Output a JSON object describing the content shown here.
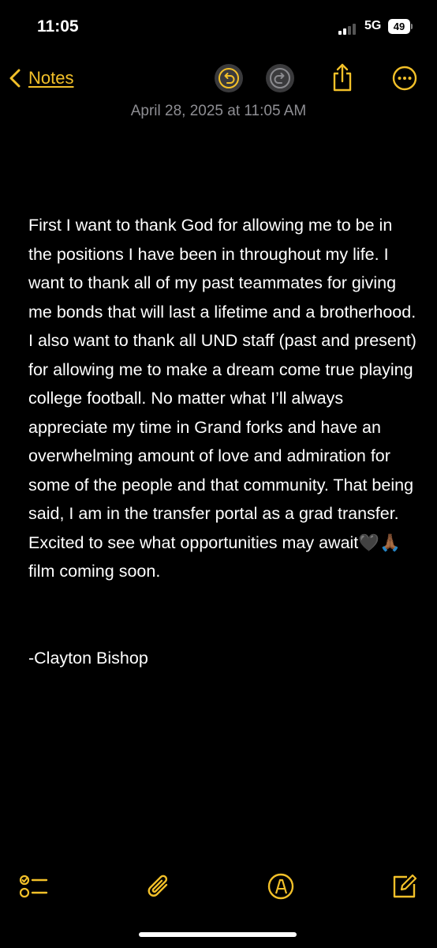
{
  "status_bar": {
    "time": "11:05",
    "network": "5G",
    "battery": "49"
  },
  "nav": {
    "back_label": "Notes"
  },
  "note": {
    "date": "April 28, 2025 at 11:05 AM",
    "body": "First I want to thank God for allowing me to be in the positions I have been in throughout my life. I want to thank all of my past teammates for giving me bonds that will last a lifetime and a brotherhood. I also want to thank all UND staff (past and present) for allowing me to make a dream come true playing college football. No matter what I’ll always appreciate my time in Grand forks and have an overwhelming amount of love and admiration for some of the people and that community. That being said, I am in the transfer portal as a grad transfer. Excited to see what opportunities may await🖤🙏🏾 film coming soon.\n\n\n-Clayton Bishop"
  },
  "colors": {
    "accent": "#f2c029",
    "background": "#000000",
    "secondary_text": "#8e8e93",
    "button_bg": "#3a3a3c"
  },
  "icons": {
    "toolbar": [
      "checklist-icon",
      "paperclip-icon",
      "markup-pen-icon",
      "compose-icon"
    ],
    "nav": [
      "chevron-left-icon",
      "undo-icon",
      "redo-icon",
      "share-icon",
      "more-icon"
    ]
  }
}
